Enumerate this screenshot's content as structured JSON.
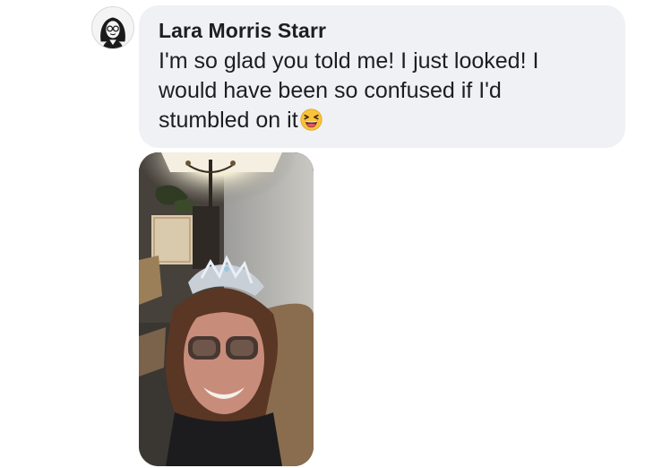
{
  "comment": {
    "author": "Lara Morris Starr",
    "message": "I'm so glad you told me! I just looked! I would have been so confused if I'd stumbled on it",
    "emoji": "laughing-squinting-face-icon"
  },
  "colors": {
    "bubble": "#eff1f4",
    "text": "#1c1e21",
    "emoji": "#f7c33b"
  }
}
